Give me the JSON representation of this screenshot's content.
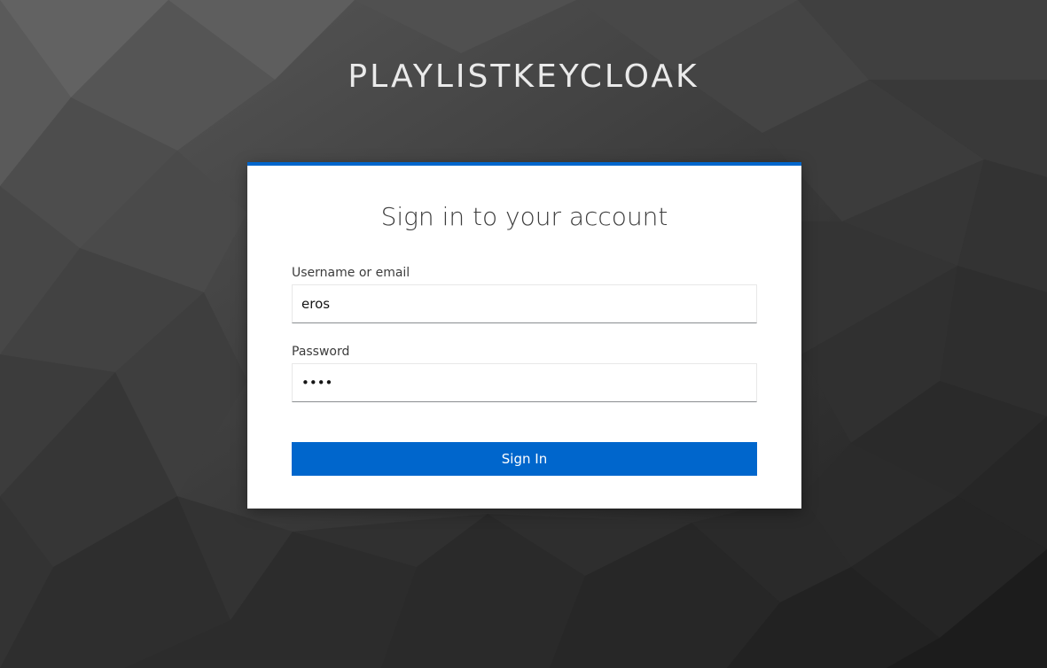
{
  "realm": {
    "title": "PLAYLISTKEYCLOAK"
  },
  "login_form": {
    "heading": "Sign in to your account",
    "username": {
      "label": "Username or email",
      "value": "eros"
    },
    "password": {
      "label": "Password",
      "value": "••••"
    },
    "submit_label": "Sign In"
  },
  "colors": {
    "accent": "#0066cc",
    "background": "#3a3a3a",
    "card": "#ffffff"
  }
}
